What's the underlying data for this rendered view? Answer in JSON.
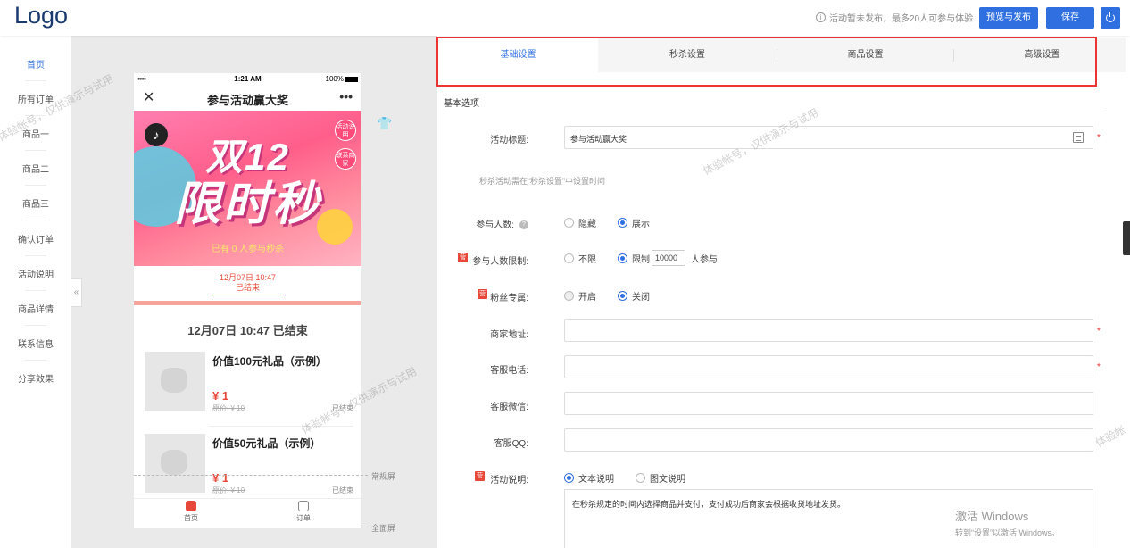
{
  "header": {
    "logo": "Logo",
    "publish_hint": "活动暂未发布，最多20人可参与体验",
    "preview_publish_label": "预览与发布",
    "save_label": "保存"
  },
  "sidebar": {
    "items": [
      {
        "label": "首页",
        "active": true
      },
      {
        "label": "所有订单"
      },
      {
        "label": "商品一"
      },
      {
        "label": "商品二"
      },
      {
        "label": "商品三"
      },
      {
        "label": "确认订单"
      },
      {
        "label": "活动说明"
      },
      {
        "label": "商品详情"
      },
      {
        "label": "联系信息"
      },
      {
        "label": "分享效果"
      }
    ]
  },
  "phone": {
    "signal": "•••••",
    "time": "1:21 AM",
    "battery": "100%",
    "close": "✕",
    "title": "参与活动赢大奖",
    "more": "•••",
    "banner": {
      "line1": "双12",
      "line2": "限时秒",
      "badge1": "活动说明",
      "badge2": "联系商家",
      "join_text": "已有 0 人参与秒杀"
    },
    "countdown": {
      "time": "12月07日 10:47",
      "status": "已结束"
    },
    "ended_title": "12月07日 10:47 已结束",
    "products": [
      {
        "name": "价值100元礼品（示例）",
        "price": "¥ 1",
        "original": "原价: ¥ 10",
        "status": "已结束"
      },
      {
        "name": "价值50元礼品（示例）",
        "price": "¥ 1",
        "original": "原价: ¥ 10",
        "status": "已结束"
      }
    ],
    "tabbar": {
      "home": "首页",
      "orders": "订单"
    }
  },
  "guides": {
    "normal": "常规屏",
    "full": "全面屏"
  },
  "tabs": [
    "基础设置",
    "秒杀设置",
    "商品设置",
    "高级设置"
  ],
  "form": {
    "section_title": "基本选项",
    "activity_title_label": "活动标题:",
    "activity_title_value": "参与活动赢大奖",
    "time_hint": "秒杀活动需在“秒杀设置”中设置时间",
    "participants_label": "参与人数:",
    "participants_options": [
      "隐藏",
      "展示"
    ],
    "limit_label": "参与人数限制:",
    "limit_options": [
      "不限",
      "限制"
    ],
    "limit_value": "10000",
    "limit_unit": "人参与",
    "fans_label": "粉丝专属:",
    "fans_options": [
      "开启",
      "关闭"
    ],
    "address_label": "商家地址:",
    "phone_label": "客服电话:",
    "wechat_label": "客服微信:",
    "qq_label": "客服QQ:",
    "desc_label": "活动说明:",
    "desc_options": [
      "文本说明",
      "图文说明"
    ],
    "desc_text": "在秒杀规定的时间内选择商品并支付，支付成功后商家会根据收货地址发货。",
    "required_mark": "*"
  },
  "watermark": "体验帐号，仅供演示与试用",
  "watermark_short": "体验帐",
  "activate": {
    "title": "激活 Windows",
    "sub": "转到“设置”以激活 Windows。"
  }
}
